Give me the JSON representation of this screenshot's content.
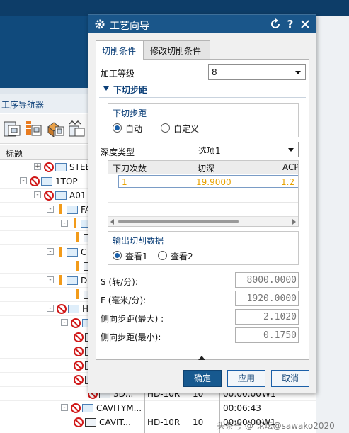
{
  "navigator": {
    "title": "工序导航器",
    "column_header": "标题",
    "toolbar_icons": [
      "program-view-icon",
      "tool-view-icon",
      "geometry-view-icon",
      "method-view-icon"
    ],
    "rows": [
      {
        "name": "STEEL",
        "tool": "",
        "num": "",
        "time": "",
        "extra": ""
      },
      {
        "name": "1TOP",
        "tool": "",
        "num": "",
        "time": "",
        "extra": ""
      },
      {
        "name": "A01",
        "tool": "",
        "num": "",
        "time": "",
        "extra": ""
      },
      {
        "name": "FA",
        "tool": "",
        "num": "",
        "time": "",
        "extra": ""
      },
      {
        "name": "",
        "tool": "",
        "num": "",
        "time": "",
        "extra": ""
      },
      {
        "name": "",
        "tool": "",
        "num": "",
        "time": "",
        "extra": ""
      },
      {
        "name": "CT",
        "tool": "",
        "num": "",
        "time": "",
        "extra": ""
      },
      {
        "name": "",
        "tool": "",
        "num": "",
        "time": "",
        "extra": ""
      },
      {
        "name": "DI",
        "tool": "",
        "num": "",
        "time": "",
        "extra": ""
      },
      {
        "name": "",
        "tool": "",
        "num": "",
        "time": "",
        "extra": ""
      },
      {
        "name": "HS",
        "tool": "",
        "num": "",
        "time": "",
        "extra": ""
      },
      {
        "name": "",
        "tool": "",
        "num": "",
        "time": "",
        "extra": ""
      },
      {
        "name": "",
        "tool": "",
        "num": "",
        "time": "",
        "extra": ""
      },
      {
        "name": "",
        "tool": "",
        "num": "",
        "time": "",
        "extra": ""
      },
      {
        "name": "",
        "tool": "",
        "num": "",
        "time": "",
        "extra": ""
      },
      {
        "name": "",
        "tool": "",
        "num": "",
        "time": "",
        "extra": ""
      },
      {
        "name": "3D...",
        "tool": "HD-10R",
        "num": "10",
        "time": "00:00:00",
        "extra": "W1"
      },
      {
        "name": "CAVITYM...",
        "tool": "",
        "num": "",
        "time": "00:06:43",
        "extra": ""
      },
      {
        "name": "CAVIT...",
        "tool": "HD-10R",
        "num": "10",
        "time": "00:00:00",
        "extra": "W1"
      }
    ]
  },
  "dialog": {
    "title": "工艺向导",
    "title_icons": [
      "reset-icon",
      "help-icon",
      "close-icon"
    ],
    "tabs": [
      "切削条件",
      "修改切削条件"
    ],
    "machining_level_label": "加工等级",
    "machining_level_value": "8",
    "section_title": "下切步距",
    "step_group": {
      "title": "下切步距",
      "options": [
        {
          "label": "自动",
          "selected": true
        },
        {
          "label": "自定义",
          "selected": false
        }
      ]
    },
    "depth_type_label": "深度类型",
    "depth_type_value": "选项1",
    "grid": {
      "columns": [
        "下刀次数",
        "切深",
        "ACP"
      ],
      "rows": [
        [
          "1",
          "19.9000",
          "1.2"
        ]
      ]
    },
    "output_group": {
      "title": "输出切削数据",
      "options": [
        {
          "label": "查看1",
          "selected": true
        },
        {
          "label": "查看2",
          "selected": false
        }
      ]
    },
    "fields": [
      {
        "label": "S (转/分):",
        "value": "8000.0000"
      },
      {
        "label": "F (毫米/分):",
        "value": "1920.0000"
      },
      {
        "label": "侧向步距(最大) :",
        "value": "2.1020"
      },
      {
        "label": "侧向步距(最小):",
        "value": "0.1750"
      }
    ],
    "buttons": {
      "ok": "确定",
      "apply": "应用",
      "cancel": "取消"
    }
  },
  "watermark": "头条号 @ 论坛@sawako2020",
  "colors": {
    "title_bar": "#1a568a",
    "accent": "#0b3f78",
    "error": "#d01818",
    "warning": "#f29b1a",
    "grid_value": "#e8a200"
  }
}
